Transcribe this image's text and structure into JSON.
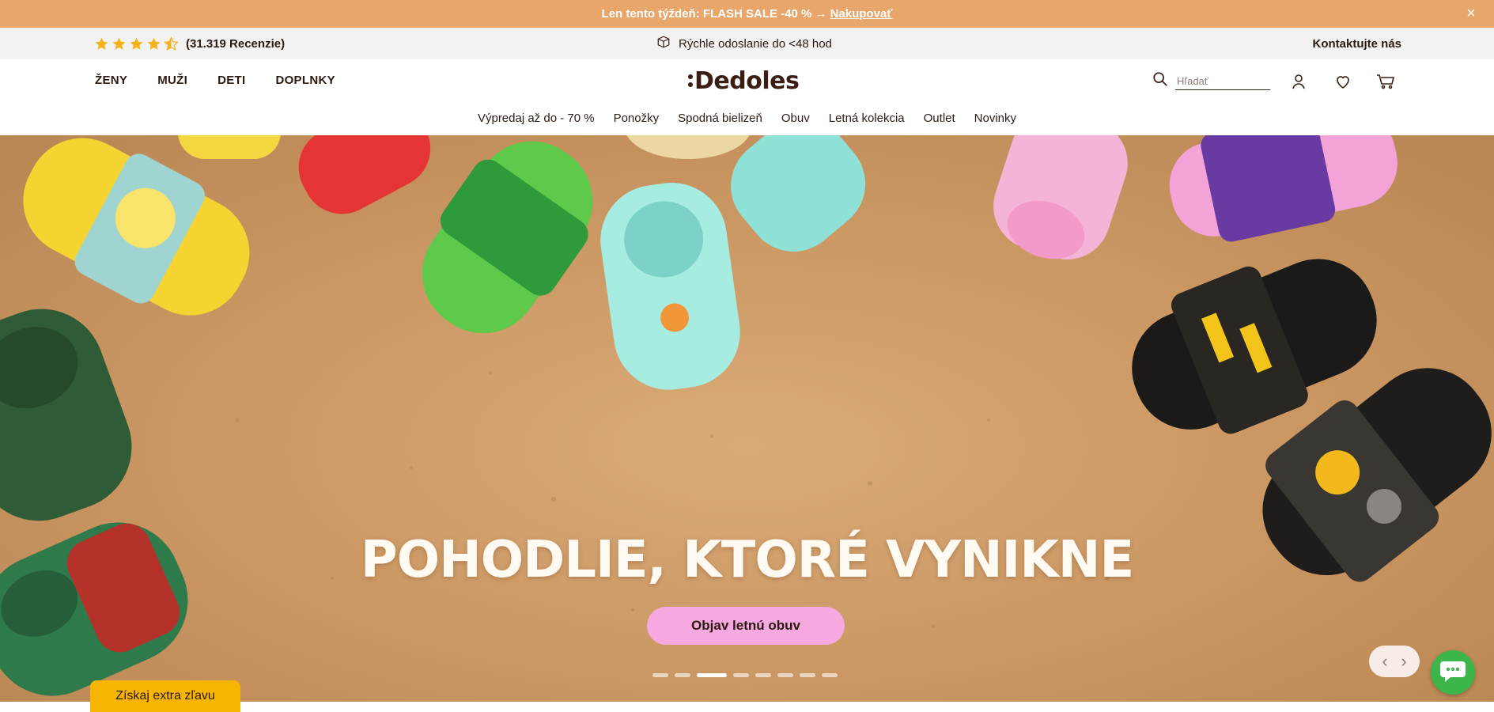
{
  "promo": {
    "text": "Len tento týždeň: FLASH SALE -40 % →",
    "link": "Nakupovať",
    "close_icon": "×"
  },
  "infobar": {
    "rating_stars": 4.5,
    "reviews": "(31.319 Recenzie)",
    "shipping": "Rýchle odoslanie do <48 hod",
    "contact": "Kontaktujte nás"
  },
  "header": {
    "categories": [
      "ŽENY",
      "MUŽI",
      "DETI",
      "DOPLNKY"
    ],
    "logo": "Dedoles",
    "search_placeholder": "Hľadať",
    "subnav": [
      "Výpredaj až do - 70 %",
      "Ponožky",
      "Spodná bielizeň",
      "Obuv",
      "Letná kolekcia",
      "Outlet",
      "Novinky"
    ]
  },
  "hero": {
    "headline": "POHODLIE, KTORÉ VYNIKNE",
    "cta": "Objav letnú obuv",
    "slide_count": 8,
    "active_slide": 3,
    "prev": "‹",
    "next": "›"
  },
  "widgets": {
    "discount": "Získaj extra zľavu"
  },
  "colors": {
    "promo_bg": "#e8a66b",
    "brand_brown": "#3a1e14",
    "cta_pink": "#f6a8e0",
    "discount_yellow": "#f7b500",
    "chat_green": "#3cb64a"
  }
}
